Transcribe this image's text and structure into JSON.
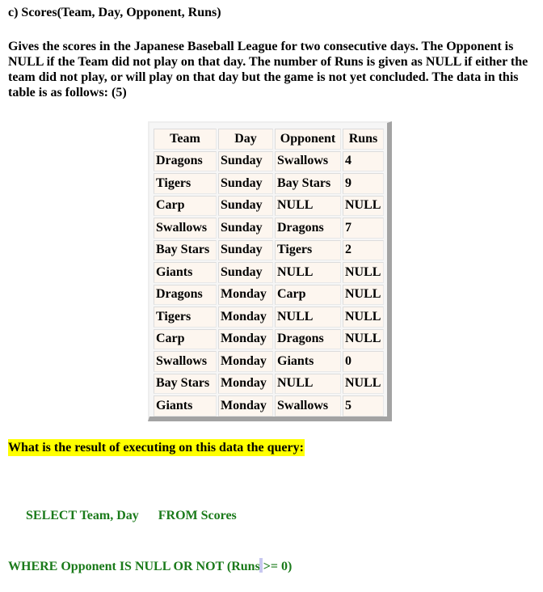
{
  "heading": "c) Scores(Team, Day, Opponent, Runs)",
  "description": "Gives the scores in the Japanese Baseball League for two consecutive days. The Opponent is NULL if the Team did not play on that day. The number of Runs is given as NULL if either the team did not play, or will play on that day but the game is not yet concluded. The data in this table is as follows:  (5)",
  "table": {
    "columns": [
      "Team",
      "Day",
      "Opponent",
      "Runs"
    ],
    "rows": [
      [
        "Dragons",
        "Sunday",
        "Swallows",
        "4"
      ],
      [
        "Tigers",
        "Sunday",
        "Bay Stars",
        "9"
      ],
      [
        "Carp",
        "Sunday",
        "NULL",
        "NULL"
      ],
      [
        "Swallows",
        "Sunday",
        "Dragons",
        "7"
      ],
      [
        "Bay Stars",
        "Sunday",
        "Tigers",
        "2"
      ],
      [
        "Giants",
        "Sunday",
        "NULL",
        "NULL"
      ],
      [
        "Dragons",
        "Monday",
        "Carp",
        "NULL"
      ],
      [
        "Tigers",
        "Monday",
        "NULL",
        "NULL"
      ],
      [
        "Carp",
        "Monday",
        "Dragons",
        "NULL"
      ],
      [
        "Swallows",
        "Monday",
        "Giants",
        "0"
      ],
      [
        "Bay Stars",
        "Monday",
        "NULL",
        "NULL"
      ],
      [
        "Giants",
        "Monday",
        "Swallows",
        "5"
      ]
    ]
  },
  "question": "What is the result of executing on this data the query:",
  "query": {
    "line1": "SELECT Team, Day      FROM Scores",
    "line2_before_caret": "WHERE Opponent IS NULL OR NOT (Runs",
    "line2_after_caret": " >= 0)"
  },
  "colors": {
    "highlight": "#ffff00",
    "query_text": "#1a7a1a",
    "cell_background": "#fdf6ef"
  }
}
